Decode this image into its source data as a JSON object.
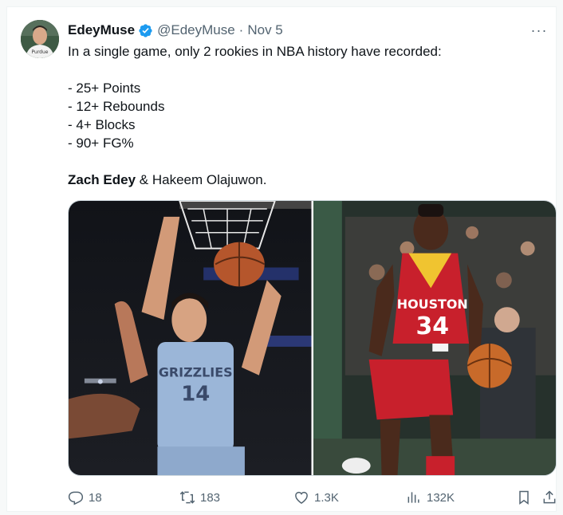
{
  "tweet": {
    "author_name": "EdeyMuse",
    "handle": "@EdeyMuse",
    "separator": "·",
    "date": "Nov 5",
    "more_label": "···",
    "line1": "In a single game, only 2 rookies in NBA history have recorded:",
    "stats": [
      "- 25+ Points",
      "- 12+ Rebounds",
      "- 4+ Blocks",
      "- 90+ FG%"
    ],
    "player1": "Zach Edey",
    "conj_rest": " & Hakeem Olajuwon.",
    "avatar_jersey_text": "Purdue"
  },
  "photos": {
    "left": {
      "jersey_team": "GRIZZLIES",
      "jersey_number": "14"
    },
    "right": {
      "jersey_team": "HOUSTON",
      "jersey_number": "34"
    }
  },
  "actions": {
    "replies": "18",
    "reposts": "183",
    "likes": "1.3K",
    "views": "132K"
  },
  "colors": {
    "verified": "#1d9bf0",
    "secondary_text": "#536471",
    "grizzlies_blue": "#9bb6d8",
    "rockets_red": "#c8202c"
  }
}
